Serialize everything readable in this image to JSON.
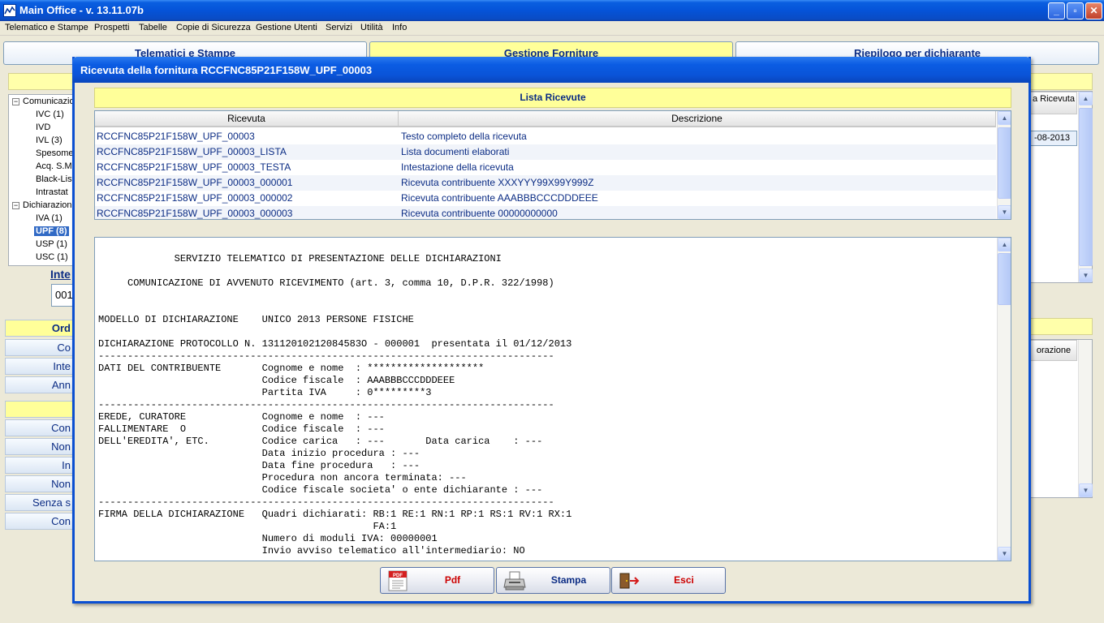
{
  "window": {
    "title": "Main Office - v. 13.11.07b",
    "controls": {
      "minimize": "_",
      "maximize": "▫",
      "close": "✕"
    }
  },
  "menu": [
    "Telematico e Stampe",
    "Prospetti",
    "Tabelle",
    "Copie di Sicurezza",
    "Gestione Utenti",
    "Servizi",
    "Utilità",
    "Info"
  ],
  "tabs": [
    "Telematici e Stampe",
    "Gestione Forniture",
    "Riepilogo per dichiarante"
  ],
  "tree": {
    "groups": [
      "Comunicazio",
      "Dichiarazioni"
    ],
    "items": [
      "IVC (1)",
      "IVD",
      "IVL (3)",
      "Spesome",
      "Acq. S.M",
      "Black-List",
      "Intrastat",
      "IVA (1)",
      "UPF (8)",
      "USP (1)",
      "USC (1)"
    ],
    "expand_symbol": "−"
  },
  "side": {
    "inte_label": "Inte",
    "inte_value": "001",
    "buttons": [
      "Ord",
      "Co",
      "Inte",
      "Ann",
      "",
      "Con",
      "Non",
      "In",
      "Non",
      "Senza s",
      "Con"
    ]
  },
  "right_panel": {
    "header_top": "a Ricevuta",
    "date_cell": "-08-2013",
    "header_bottom": "orazione"
  },
  "dialog": {
    "title": "Ricevuta della fornitura RCCFNC85P21F158W_UPF_00003",
    "list_title": "Lista Ricevute",
    "columns": [
      "Ricevuta",
      "Descrizione"
    ],
    "rows": [
      {
        "ricevuta": "RCCFNC85P21F158W_UPF_00003",
        "descrizione": "Testo completo della ricevuta"
      },
      {
        "ricevuta": "RCCFNC85P21F158W_UPF_00003_LISTA",
        "descrizione": "Lista documenti elaborati"
      },
      {
        "ricevuta": "RCCFNC85P21F158W_UPF_00003_TESTA",
        "descrizione": "Intestazione della ricevuta"
      },
      {
        "ricevuta": "RCCFNC85P21F158W_UPF_00003_000001",
        "descrizione": "Ricevuta contribuente XXXYYY99X99Y999Z"
      },
      {
        "ricevuta": "RCCFNC85P21F158W_UPF_00003_000002",
        "descrizione": "Ricevuta contribuente AAABBBCCCDDDEEE"
      },
      {
        "ricevuta": "RCCFNC85P21F158W_UPF_00003_000003",
        "descrizione": "Ricevuta contribuente 00000000000"
      }
    ],
    "receipt_lines": [
      "",
      "             SERVIZIO TELEMATICO DI PRESENTAZIONE DELLE DICHIARAZIONI",
      "",
      "     COMUNICAZIONE DI AVVENUTO RICEVIMENTO (art. 3, comma 10, D.P.R. 322/1998)",
      "",
      "",
      "MODELLO DI DICHIARAZIONE    UNICO 2013 PERSONE FISICHE",
      "",
      "DICHIARAZIONE PROTOCOLLO N. 13112010212084583O - 000001  presentata il 01/12/2013",
      "------------------------------------------------------------------------------",
      "DATI DEL CONTRIBUENTE       Cognome e nome  : ********************",
      "                            Codice fiscale  : AAABBBCCCDDDEEE",
      "                            Partita IVA     : 0*********3",
      "------------------------------------------------------------------------------",
      "EREDE, CURATORE             Cognome e nome  : ---",
      "FALLIMENTARE  O             Codice fiscale  : ---",
      "DELL'EREDITA', ETC.         Codice carica   : ---       Data carica    : ---",
      "                            Data inizio procedura : ---",
      "                            Data fine procedura   : ---",
      "                            Procedura non ancora terminata: ---",
      "                            Codice fiscale societa' o ente dichiarante : ---",
      "------------------------------------------------------------------------------",
      "FIRMA DELLA DICHIARAZIONE   Quadri dichiarati: RB:1 RE:1 RN:1 RP:1 RS:1 RV:1 RX:1",
      "                                               FA:1",
      "                            Numero di moduli IVA: 00000001",
      "                            Invio avviso telematico all'intermediario: NO"
    ],
    "buttons": {
      "pdf": "Pdf",
      "stampa": "Stampa",
      "esci": "Esci"
    },
    "pdf_icon_text": "PDF"
  },
  "colors": {
    "accent_text": "#0b2c84",
    "highlight": "#ffff99",
    "pdf_label": "#cc0000",
    "esci_label": "#cc0000",
    "stampa_label": "#0b2c84"
  }
}
